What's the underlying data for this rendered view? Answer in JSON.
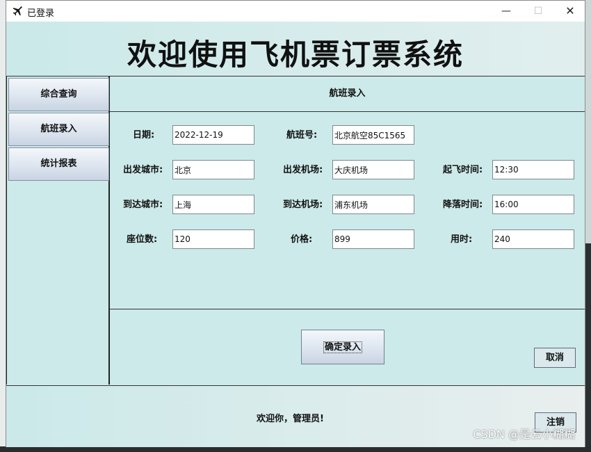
{
  "window": {
    "title": "已登录",
    "icon": "airplane-icon",
    "controls": {
      "minimize": "—",
      "maximize": "☐",
      "close": "✕"
    }
  },
  "header": {
    "title": "欢迎使用飞机票订票系统"
  },
  "sidebar": {
    "items": [
      {
        "label": "综合查询"
      },
      {
        "label": "航班录入"
      },
      {
        "label": "统计报表"
      }
    ]
  },
  "main": {
    "section_title": "航班录入",
    "fields": {
      "date": {
        "label": "日期:",
        "value": "2022-12-19"
      },
      "flight_no": {
        "label": "航班号:",
        "value": "北京航空85C1565"
      },
      "dep_city": {
        "label": "出发城市:",
        "value": "北京"
      },
      "dep_airport": {
        "label": "出发机场:",
        "value": "大庆机场"
      },
      "dep_time": {
        "label": "起飞时间:",
        "value": "12:30"
      },
      "arr_city": {
        "label": "到达城市:",
        "value": "上海"
      },
      "arr_airport": {
        "label": "到达机场:",
        "value": "浦东机场"
      },
      "arr_time": {
        "label": "降落时间:",
        "value": "16:00"
      },
      "seats": {
        "label": "座位数:",
        "value": "120"
      },
      "price": {
        "label": "价格:",
        "value": "899"
      },
      "duration": {
        "label": "用时:",
        "value": "240"
      }
    },
    "submit_label": "确定录入",
    "cancel_label": "取消"
  },
  "footer": {
    "welcome": "欢迎你，管理员!",
    "logout_label": "注销"
  },
  "watermark": "CSDN @是云小糊糊",
  "colors": {
    "panel": "#cdeaea",
    "button_top": "#f4f7fb",
    "button_bottom": "#c9d4e3"
  }
}
